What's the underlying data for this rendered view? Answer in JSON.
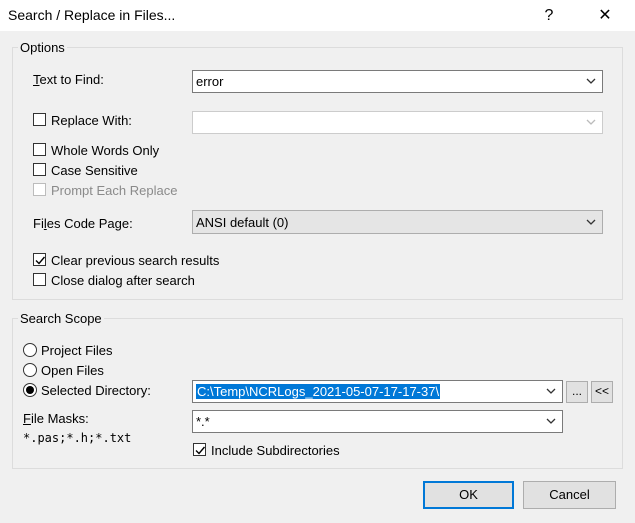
{
  "window": {
    "title": "Search / Replace in Files...",
    "help_label": "?",
    "close_label": "✕"
  },
  "options": {
    "legend": "Options",
    "text_to_find": {
      "label_accel": "T",
      "label_rest": "ext to Find:",
      "value": "error"
    },
    "replace_with": {
      "label": "Replace With:",
      "checked": false,
      "value": ""
    },
    "whole_words": {
      "label": "Whole Words Only",
      "checked": false
    },
    "case_sensitive": {
      "label": "Case Sensitive",
      "checked": false
    },
    "prompt_each": {
      "label": "Prompt Each Replace",
      "checked": false,
      "enabled": false
    },
    "code_page": {
      "label_pre": "Fi",
      "label_accel": "l",
      "label_post": "es Code Page:",
      "value": "ANSI default (0)"
    },
    "clear_results": {
      "label": "Clear previous search results",
      "checked": true
    },
    "close_after": {
      "label": "Close dialog after search",
      "checked": false
    }
  },
  "scope": {
    "legend": "Search Scope",
    "project_files": {
      "label": "Project Files",
      "selected": false
    },
    "open_files": {
      "label": "Open Files",
      "selected": false
    },
    "selected_directory": {
      "label": "Selected Directory:",
      "selected": true,
      "value": "C:\\Temp\\NCRLogs_2021-05-07-17-17-37\\"
    },
    "browse_label": "...",
    "expand_label": "<<",
    "file_masks": {
      "label_accel": "F",
      "label_rest": "ile Masks:",
      "value": "*.*",
      "hint": "*.pas;*.h;*.txt"
    },
    "include_subdirs": {
      "label": "Include Subdirectories",
      "checked": true
    }
  },
  "buttons": {
    "ok_label": "OK",
    "cancel_label": "Cancel"
  },
  "colors": {
    "background": "#f0f0f0",
    "selection": "#0078d7",
    "default_button_border": "#0078d7"
  }
}
